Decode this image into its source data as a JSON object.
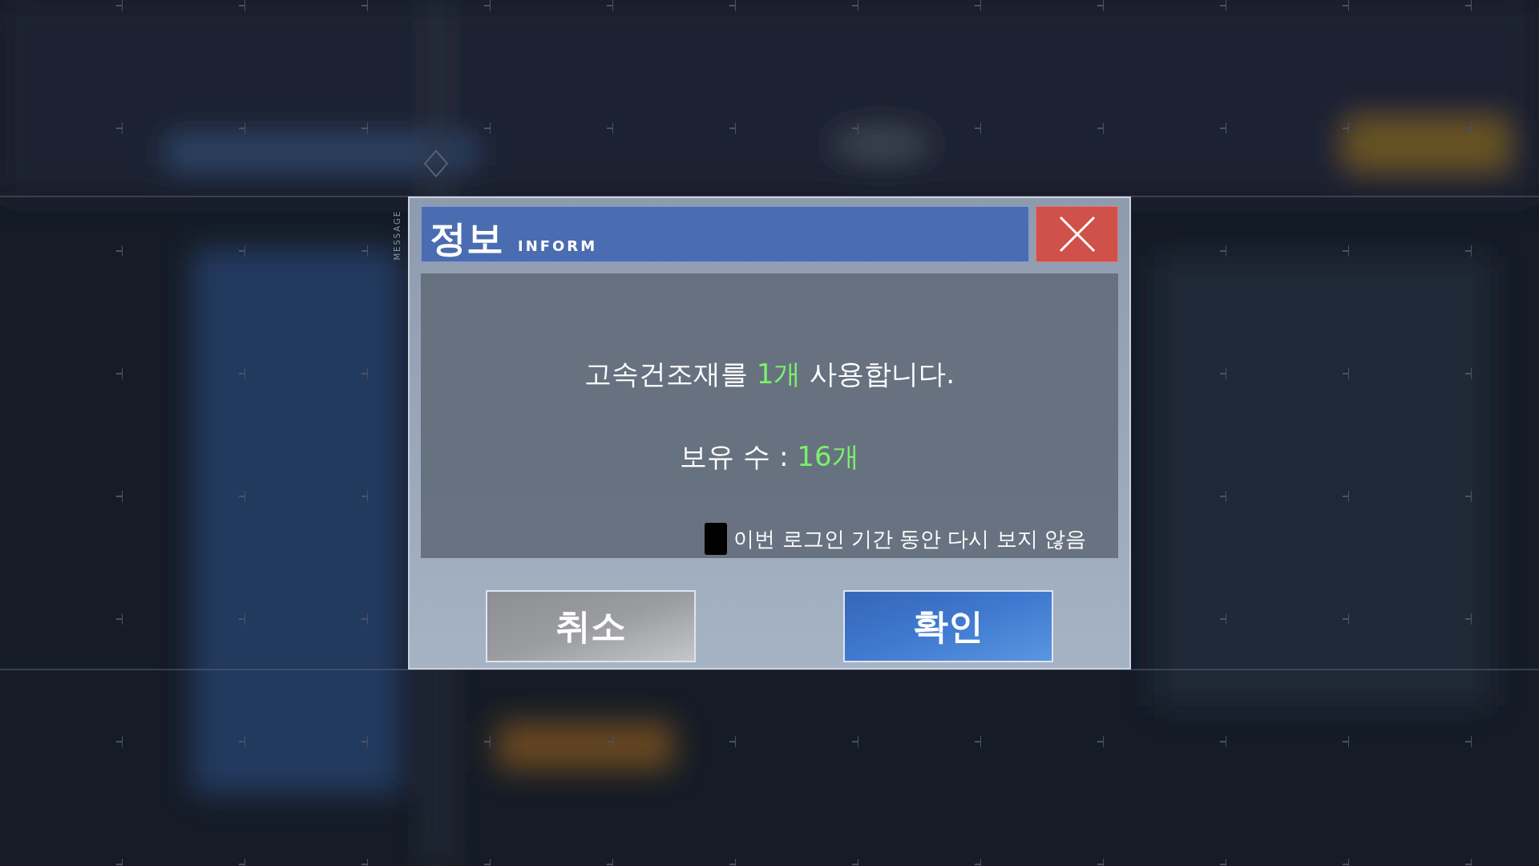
{
  "side_label": "MESSAGE",
  "dialog": {
    "title": "정보",
    "subtitle": "INFORM",
    "message": [
      {
        "text": "고속건조재를 ",
        "highlight": false
      },
      {
        "text": "1개",
        "highlight": true
      },
      {
        "text": " 사용합니다.",
        "highlight": false
      }
    ],
    "count": [
      {
        "text": "보유 수 : ",
        "highlight": false
      },
      {
        "text": "16개",
        "highlight": true
      }
    ],
    "dont_show": {
      "label": "이번 로그인 기간 동안 다시 보지 않음",
      "checked": false
    },
    "buttons": [
      {
        "label": "취소",
        "kind": "cancel"
      },
      {
        "label": "확인",
        "kind": "confirm"
      }
    ]
  }
}
